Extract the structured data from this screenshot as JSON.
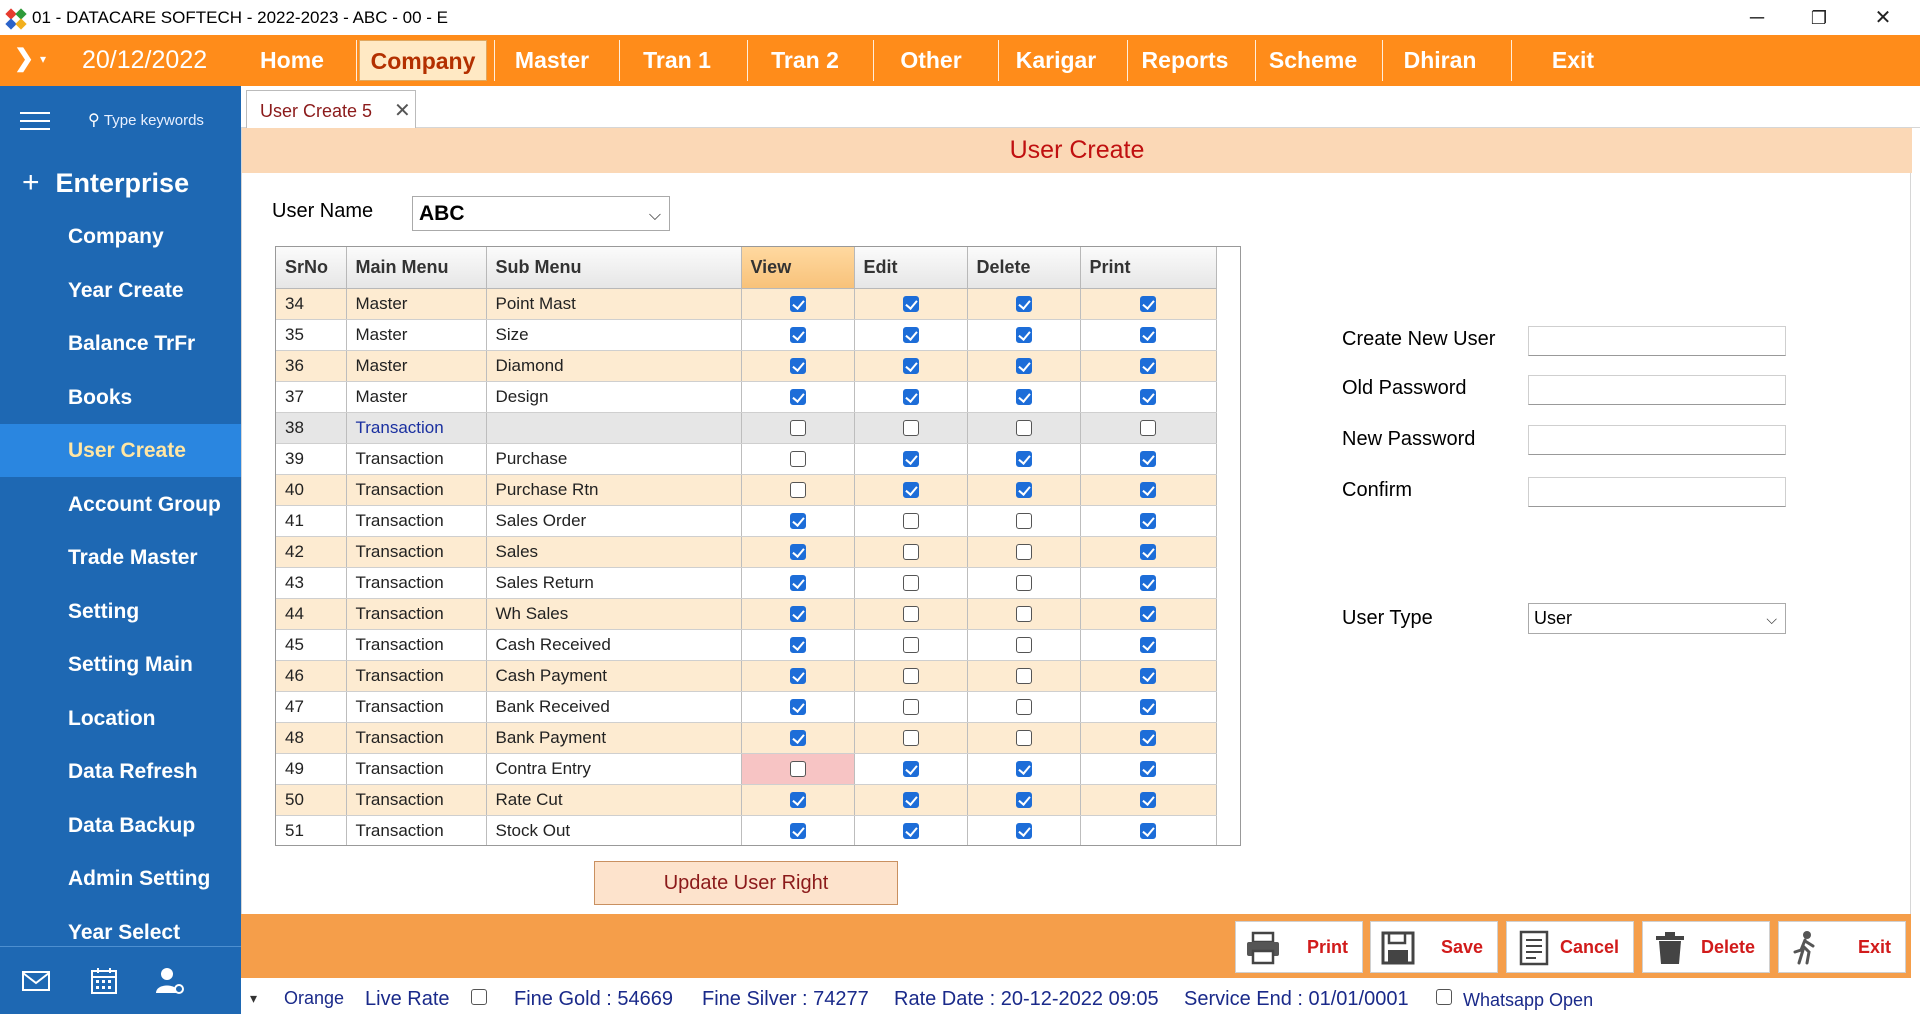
{
  "window": {
    "title": "01 - DATACARE SOFTECH - 2022-2023 - ABC - 00 - E",
    "minimize": "─",
    "restore": "❐",
    "close": "✕"
  },
  "menubar": {
    "date": "20/12/2022",
    "items": [
      "Home",
      "Company",
      "Master",
      "Tran 1",
      "Tran 2",
      "Other",
      "Karigar",
      "Reports",
      "Scheme",
      "Dhiran",
      "Exit"
    ],
    "active": "Company"
  },
  "sidebar": {
    "search_placeholder": "Type keywords",
    "section": "Enterprise",
    "items": [
      "Company",
      "Year Create",
      "Balance TrFr",
      "Books",
      "User Create",
      "Account Group",
      "Trade Master",
      "Setting",
      "Setting Main",
      "Location",
      "Data Refresh",
      "Data Backup",
      "Admin Setting",
      "Year Select"
    ],
    "active": "User Create",
    "bottom_icons": [
      "mail-icon",
      "calendar-icon",
      "user-settings-icon"
    ]
  },
  "tab": {
    "label": "User Create 5",
    "close": "✕"
  },
  "form": {
    "header": "User Create",
    "user_name_label": "User Name",
    "user_name_value": "ABC",
    "update_button": "Update User Right",
    "create_new_user_label": "Create New User",
    "old_password_label": "Old Password",
    "new_password_label": "New Password",
    "confirm_label": "Confirm",
    "user_type_label": "User Type",
    "user_type_value": "User"
  },
  "grid": {
    "columns": [
      "SrNo",
      "Main Menu",
      "Sub Menu",
      "View",
      "Edit",
      "Delete",
      "Print"
    ],
    "rows": [
      {
        "srno": "34",
        "main": "Master",
        "sub": "Point Mast",
        "view": true,
        "edit": true,
        "delete": true,
        "print": true
      },
      {
        "srno": "35",
        "main": "Master",
        "sub": "Size",
        "view": true,
        "edit": true,
        "delete": true,
        "print": true
      },
      {
        "srno": "36",
        "main": "Master",
        "sub": "Diamond",
        "view": true,
        "edit": true,
        "delete": true,
        "print": true
      },
      {
        "srno": "37",
        "main": "Master",
        "sub": "Design",
        "view": true,
        "edit": true,
        "delete": true,
        "print": true
      },
      {
        "srno": "38",
        "main": "Transaction",
        "sub": "",
        "view": false,
        "edit": false,
        "delete": false,
        "print": false,
        "selected": true
      },
      {
        "srno": "39",
        "main": "Transaction",
        "sub": "Purchase",
        "view": false,
        "edit": true,
        "delete": true,
        "print": true
      },
      {
        "srno": "40",
        "main": "Transaction",
        "sub": "Purchase Rtn",
        "view": false,
        "edit": true,
        "delete": true,
        "print": true
      },
      {
        "srno": "41",
        "main": "Transaction",
        "sub": "Sales Order",
        "view": true,
        "edit": false,
        "delete": false,
        "print": true
      },
      {
        "srno": "42",
        "main": "Transaction",
        "sub": "Sales",
        "view": true,
        "edit": false,
        "delete": false,
        "print": true
      },
      {
        "srno": "43",
        "main": "Transaction",
        "sub": "Sales Return",
        "view": true,
        "edit": false,
        "delete": false,
        "print": true
      },
      {
        "srno": "44",
        "main": "Transaction",
        "sub": "Wh Sales",
        "view": true,
        "edit": false,
        "delete": false,
        "print": true
      },
      {
        "srno": "45",
        "main": "Transaction",
        "sub": "Cash Received",
        "view": true,
        "edit": false,
        "delete": false,
        "print": true
      },
      {
        "srno": "46",
        "main": "Transaction",
        "sub": "Cash Payment",
        "view": true,
        "edit": false,
        "delete": false,
        "print": true
      },
      {
        "srno": "47",
        "main": "Transaction",
        "sub": "Bank Received",
        "view": true,
        "edit": false,
        "delete": false,
        "print": true
      },
      {
        "srno": "48",
        "main": "Transaction",
        "sub": "Bank Payment",
        "view": true,
        "edit": false,
        "delete": false,
        "print": true
      },
      {
        "srno": "49",
        "main": "Transaction",
        "sub": "Contra Entry",
        "view": false,
        "edit": true,
        "delete": true,
        "print": true,
        "view_error": true
      },
      {
        "srno": "50",
        "main": "Transaction",
        "sub": "Rate Cut",
        "view": true,
        "edit": true,
        "delete": true,
        "print": true
      },
      {
        "srno": "51",
        "main": "Transaction",
        "sub": "Stock Out",
        "view": true,
        "edit": true,
        "delete": true,
        "print": true
      }
    ]
  },
  "actions": {
    "print": "Print",
    "save": "Save",
    "cancel": "Cancel",
    "delete": "Delete",
    "exit": "Exit"
  },
  "status": {
    "arrow": "▾",
    "theme": "Orange",
    "live_rate": "Live Rate",
    "fine_gold": "Fine Gold : 54669",
    "fine_silver": "Fine Silver : 74277",
    "rate_date": "Rate Date : 20-12-2022 09:05",
    "service_end": "Service End :  01/01/0001",
    "whatsapp": "Whatsapp Open"
  },
  "colors": {
    "menubar": "#ff8c1a",
    "sidebar": "#1e68b3",
    "sidebar_active": "#2a86e0",
    "header_bg": "#fbd8b6",
    "header_text": "#c01010",
    "action_label": "#d11b1b",
    "checkbox_on": "#1d6dd8"
  }
}
